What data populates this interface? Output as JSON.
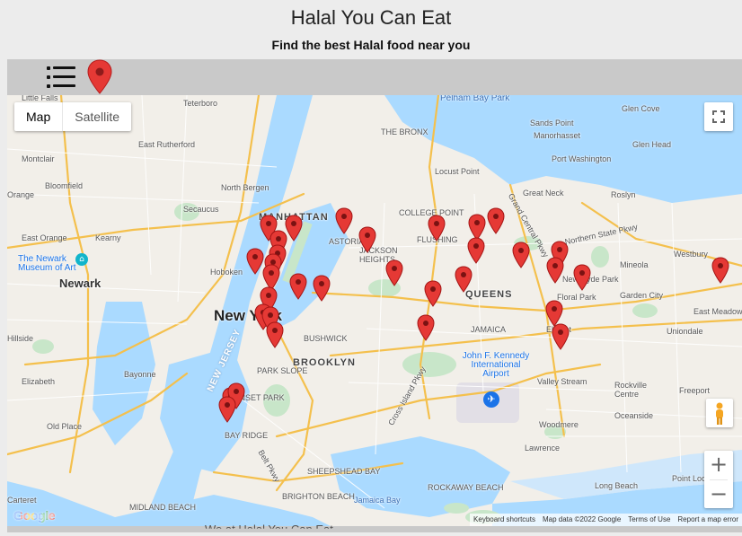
{
  "header": {
    "title": "Halal You Can Eat",
    "subtitle": "Find the best Halal food near you"
  },
  "toolbar": {
    "menu_icon": "list-icon",
    "location_icon": "map-pin-icon"
  },
  "map": {
    "maptype_map": "Map",
    "maptype_satellite": "Satellite",
    "google_logo": "Google",
    "attribution": {
      "shortcuts": "Keyboard shortcuts",
      "data": "Map data ©2022 Google",
      "terms": "Terms of Use",
      "report": "Report a map error"
    },
    "zoom_in": "+",
    "zoom_out": "−",
    "place_labels": [
      "Little Falls",
      "Teterboro",
      "Pelham Bay Park",
      "Glen Cove",
      "Sands Point",
      "Manorhasset",
      "Glen Head",
      "Montclair",
      "East Rutherford",
      "Port Washington",
      "Bloomfield",
      "North Bergen",
      "THE BRONX",
      "Locust Point",
      "Great Neck",
      "Roslyn",
      "Orange",
      "Secaucus",
      "MANHATTAN",
      "COLLEGE POINT",
      "East Orange",
      "Kearny",
      "ASTORIA",
      "JACKSON HEIGHTS",
      "FLUSHING",
      "Mineola",
      "Westbury",
      "The Newark Museum of Art",
      "Newark",
      "Hoboken",
      "New York",
      "Floral Park",
      "Garden City",
      "New Hyde Park",
      "East Meadow",
      "Hillside",
      "QUEENS",
      "JAMAICA",
      "Uniondale",
      "BUSHWICK",
      "Elizabeth",
      "Bayonne",
      "BROOKLYN",
      "PARK SLOPE",
      "John F. Kennedy International Airport",
      "Valley Stream",
      "Rockville Centre",
      "Freeport",
      "SUNSET PARK",
      "BAY RIDGE",
      "Woodmere",
      "Oceanside",
      "Old Place",
      "Lawrence",
      "SHEEPSHEAD BAY",
      "ROCKAWAY BEACH",
      "Long Beach",
      "Point Lookout",
      "Carteret",
      "BRIGHTON BEACH",
      "Jamaica Bay",
      "MIDLAND BEACH",
      "NEW JERSEY",
      "Belt Pkwy",
      "Northern State Pkwy",
      "Grand Central Pkwy",
      "Cross Island Pkwy",
      "Elmont"
    ],
    "markers_count_note": "",
    "colors": {
      "marker": "#e53935",
      "water": "#aadaff",
      "land": "#f2efe9",
      "park": "#c8e6c9",
      "highway": "#f9c74f"
    }
  },
  "footer_partial": "We at Halal You Can Eat"
}
